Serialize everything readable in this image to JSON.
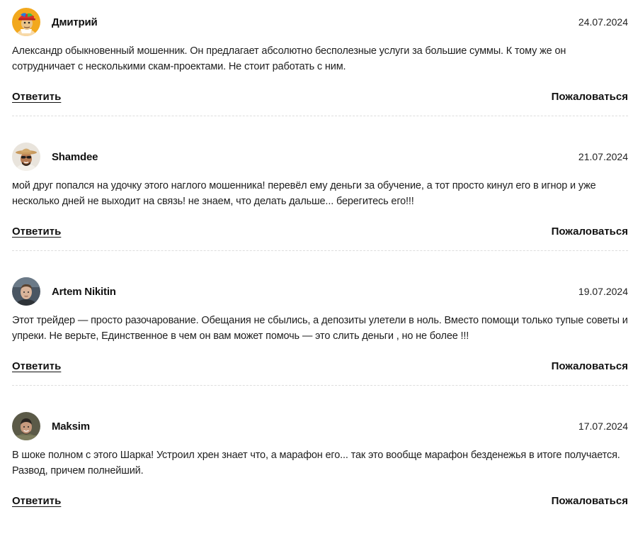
{
  "comments": [
    {
      "author": "Дмитрий",
      "date": "24.07.2024",
      "text": "Александр обыкновенный мошенник. Он предлагает абсолютно бесполезные услуги за большие суммы. К тому же он сотрудничает с несколькими скам-проектами. Не стоит работать с ним.",
      "reply_label": "Ответить",
      "complain_label": "Пожаловаться",
      "avatar_icon": "cartoon-character-avatar"
    },
    {
      "author": "Shamdee",
      "date": "21.07.2024",
      "text": "мой друг попался на удочку этого наглого мошенника! перевёл ему деньги за обучение, а тот просто кинул его в игнор и уже несколько дней не выходит на связь! не знаем, что делать дальше... берегитесь его!!!",
      "reply_label": "Ответить",
      "complain_label": "Пожаловаться",
      "avatar_icon": "man-with-hat-avatar"
    },
    {
      "author": "Artem Nikitin",
      "date": "19.07.2024",
      "text": "Этот трейдер — просто разочарование. Обещания не сбылись, а депозиты улетели в ноль. Вместо помощи только тупые советы и упреки. Не верьте, Единственное в чем он вам может помочь — это слить деньги , но не более !!!",
      "reply_label": "Ответить",
      "complain_label": "Пожаловаться",
      "avatar_icon": "man-portrait-avatar"
    },
    {
      "author": "Maksim",
      "date": "17.07.2024",
      "text": "В шоке полном с этого Шарка! Устроил хрен знает что, а марафон его... так это вообще марафон безденежья в итоге получается. Развод, причем полнейший.",
      "reply_label": "Ответить",
      "complain_label": "Пожаловаться",
      "avatar_icon": "man-in-uniform-avatar"
    }
  ]
}
